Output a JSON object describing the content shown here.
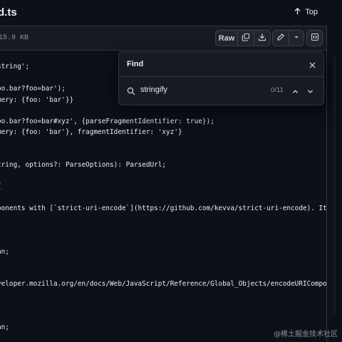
{
  "header": {
    "file_title": "d.ts",
    "top_label": "Top"
  },
  "toolbar": {
    "file_size": "15.9 KB",
    "raw_label": "Raw"
  },
  "icons": {
    "top": "arrow-up-icon",
    "copy": "copy-icon",
    "download": "download-icon",
    "edit": "pencil-icon",
    "dropdown": "chevron-down-icon",
    "symbols": "code-square-icon",
    "close": "close-icon",
    "search": "search-icon",
    "prev": "chevron-up-icon",
    "next": "chevron-down-icon"
  },
  "code": {
    "lines": [
      "string';",
      "oo.bar?foo=bar');",
      "uery: {foo: 'bar'}}",
      "oo.bar?foo=bar#xyz', {parseFragmentIdentifier: true});",
      "uery: {foo: 'bar'}, fragmentIdentifier: 'xyz'}",
      "tring, options?: ParseOptions): ParsedUrl;",
      "{",
      "ponents with [`strict-uri-encode`](https://github.com/kevva/strict-uri-encode). It u",
      "an;",
      "veloper.mozilla.org/en/docs/Web/JavaScript/Reference/Global_Objects/encodeURIComponen",
      "an;"
    ]
  },
  "find": {
    "title": "Find",
    "query": "stringify",
    "count": "0/11"
  },
  "watermark": "@稀土掘金技术社区",
  "colors": {
    "background": "#0d1117",
    "panel": "#161b22",
    "border": "#30363d",
    "text": "#e6edf3",
    "muted": "#8b949e"
  }
}
